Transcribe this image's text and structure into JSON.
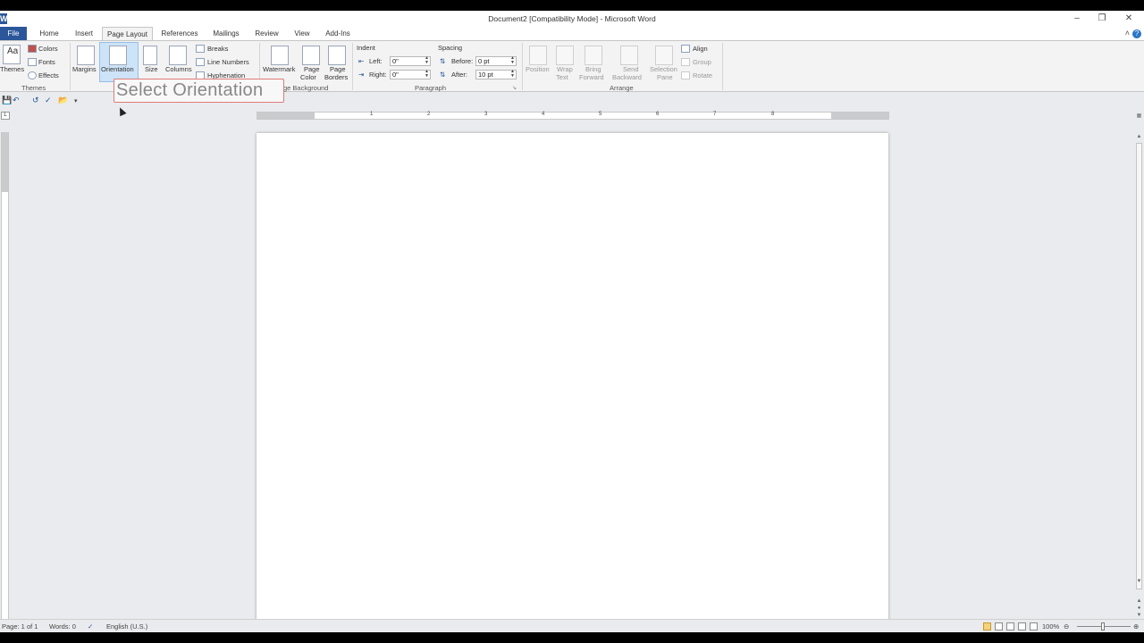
{
  "window": {
    "title": "Document2 [Compatibility Mode] - Microsoft Word",
    "app_icon": "W"
  },
  "tabs": [
    "File",
    "Home",
    "Insert",
    "Page Layout",
    "References",
    "Mailings",
    "Review",
    "View",
    "Add-Ins"
  ],
  "active_tab": "Page Layout",
  "ribbon": {
    "themes": {
      "themes_label": "Themes",
      "colors_label": "Colors",
      "fonts_label": "Fonts",
      "effects_label": "Effects",
      "group_label": "Themes"
    },
    "page_setup": {
      "margins": "Margins",
      "orientation": "Orientation",
      "size": "Size",
      "columns": "Columns",
      "breaks": "Breaks",
      "line_numbers": "Line Numbers",
      "hyphenation": "Hyphenation"
    },
    "page_background": {
      "watermark": "Watermark",
      "page_color_1": "Page",
      "page_color_2": "Color",
      "page_borders_1": "Page",
      "page_borders_2": "Borders",
      "group_label": "ge Background"
    },
    "paragraph": {
      "indent_title": "Indent",
      "left_label": "Left:",
      "left_value": "0\"",
      "right_label": "Right:",
      "right_value": "0\"",
      "spacing_title": "Spacing",
      "before_label": "Before:",
      "before_value": "0 pt",
      "after_label": "After:",
      "after_value": "10 pt",
      "group_label": "Paragraph"
    },
    "arrange": {
      "position": "Position",
      "wrap_1": "Wrap",
      "wrap_2": "Text",
      "bring_1": "Bring",
      "bring_2": "Forward",
      "send_1": "Send",
      "send_2": "Backward",
      "selection_1": "Selection",
      "selection_2": "Pane",
      "align": "Align",
      "group": "Group",
      "rotate": "Rotate",
      "group_label": "Arrange"
    }
  },
  "tooltip": "Select Orientation",
  "ruler": {
    "numbers": [
      "1",
      "2",
      "3",
      "4",
      "5",
      "6",
      "7",
      "8"
    ]
  },
  "tab_selector": "L",
  "status": {
    "page": "Page: 1 of 1",
    "words": "Words: 0",
    "language": "English (U.S.)",
    "zoom": "100%"
  },
  "icons": {
    "save": "save-icon",
    "undo": "undo-icon",
    "redo": "redo-icon",
    "spelling": "spelling-icon",
    "open": "open-folder-icon",
    "customize": "customize-qat-icon"
  }
}
